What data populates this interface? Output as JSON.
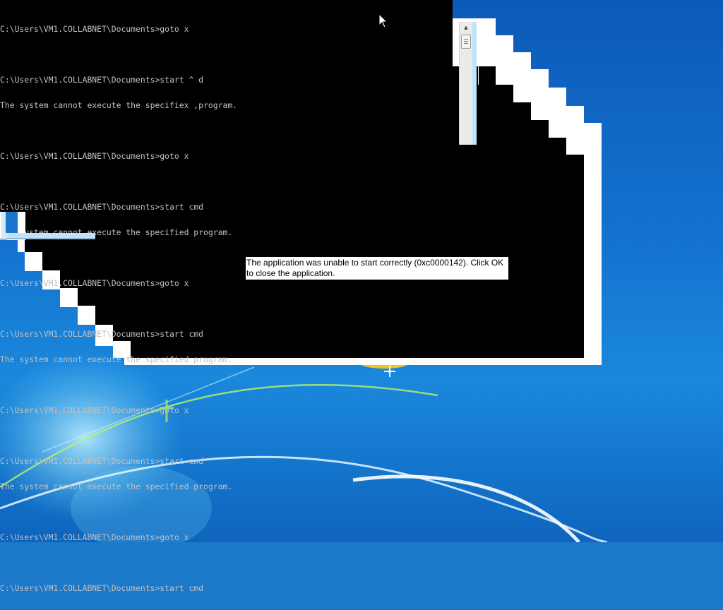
{
  "console": {
    "lines": [
      "C:\\Users\\VM1.COLLABNET\\Documents>goto x",
      "",
      "C:\\Users\\VM1.COLLABNET\\Documents>start ^ d",
      "The system cannot execute the specifiex ,program.",
      "",
      "C:\\Users\\VM1.COLLABNET\\Documents>goto x",
      "",
      "C:\\Users\\VM1.COLLABNET\\Documents>start cmd",
      "The system cannot execute the specified program.",
      "",
      "C:\\Users\\VM1.COLLABNET\\Documents>goto x",
      "",
      "C:\\Users\\VM1.COLLABNET\\Documents>start cmd",
      "The system cannot execute the specified program.",
      "",
      "C:\\Users\\VM1.COLLABNET\\Documents>goto x",
      "",
      "C:\\Users\\VM1.COLLABNET\\Documents>start cmd",
      "The system cannot execute the specified program.",
      "",
      "C:\\Users\\VM1.COLLABNET\\Documents>goto x",
      "",
      "C:\\Users\\VM1.COLLABNET\\Documents>start cmd"
    ]
  },
  "dialog": {
    "message": "The application was unable to start correctly (0xc0000142). Click OK to close the application."
  },
  "icons": {
    "cursor": "arrow-cursor-icon",
    "scroll_up": "scroll-up-arrow-icon"
  },
  "colors": {
    "console_background": "#000000",
    "console_text": "#c0c0c0",
    "desktop_background": "#1c78c9",
    "dialog_background": "#ffffff"
  }
}
